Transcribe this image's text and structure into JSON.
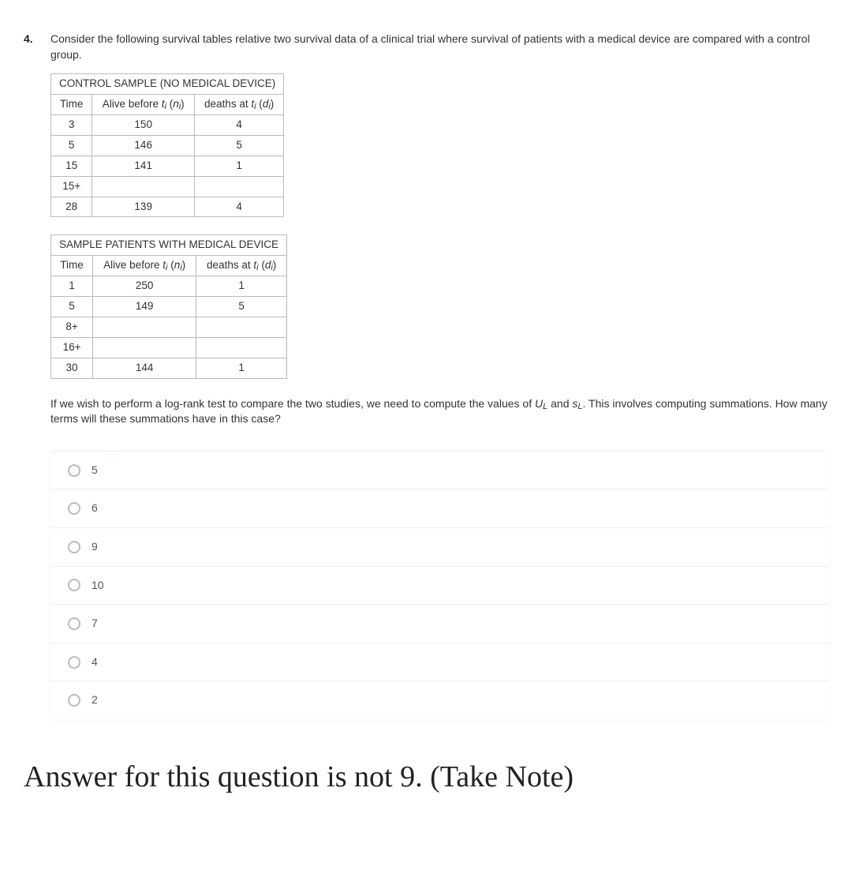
{
  "question": {
    "number": "4.",
    "prompt": "Consider the following survival tables relative two survival data of a clinical trial where survival of patients with  a medical device are compared with a control group.",
    "table1": {
      "title": "CONTROL SAMPLE (NO MEDICAL DEVICE)",
      "hdr_time": "Time",
      "hdr_alive_a": "Alive before ",
      "hdr_alive_t": "t",
      "hdr_alive_i": "i",
      "hdr_alive_b": " (",
      "hdr_alive_n": "n",
      "hdr_alive_c": ")",
      "hdr_deaths_a": "deaths at ",
      "hdr_deaths_t": "t",
      "hdr_deaths_i": "i",
      "hdr_deaths_b": " (",
      "hdr_deaths_d": "d",
      "hdr_deaths_c": ")",
      "rows": [
        {
          "time": "3",
          "alive": "150",
          "deaths": "4"
        },
        {
          "time": "5",
          "alive": "146",
          "deaths": "5"
        },
        {
          "time": "15",
          "alive": "141",
          "deaths": "1"
        },
        {
          "time": "15+",
          "alive": "",
          "deaths": ""
        },
        {
          "time": "28",
          "alive": "139",
          "deaths": "4"
        }
      ]
    },
    "table2": {
      "title": "SAMPLE PATIENTS WITH MEDICAL DEVICE",
      "rows": [
        {
          "time": "1",
          "alive": "250",
          "deaths": "1"
        },
        {
          "time": "5",
          "alive": "149",
          "deaths": "5"
        },
        {
          "time": "8+",
          "alive": "",
          "deaths": ""
        },
        {
          "time": "16+",
          "alive": "",
          "deaths": ""
        },
        {
          "time": "30",
          "alive": "144",
          "deaths": "1"
        }
      ]
    },
    "followup_a": "If we wish to perform a log-rank test to compare the two studies, we need to compute the values of ",
    "followup_U": "U",
    "followup_L1": "L",
    "followup_and": " and ",
    "followup_s": "s",
    "followup_L2": "L",
    "followup_b": ". This involves computing summations. How many terms will these summations have in this case?",
    "options": [
      "5",
      "6",
      "9",
      "10",
      "7",
      "4",
      "2"
    ]
  },
  "note": "Answer for this question is not 9. (Take Note)"
}
